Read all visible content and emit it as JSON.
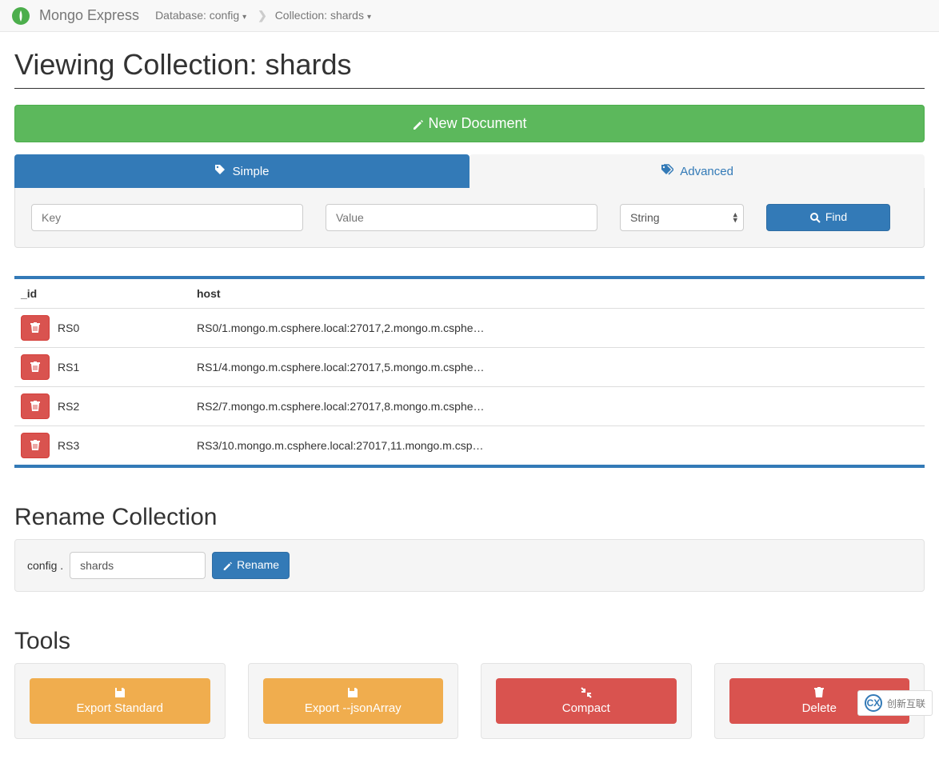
{
  "navbar": {
    "brand": "Mongo Express",
    "db_label": "Database: config",
    "col_label": "Collection: shards"
  },
  "page": {
    "title": "Viewing Collection: shards"
  },
  "new_doc": {
    "label": "New Document"
  },
  "tabs": {
    "simple": "Simple",
    "advanced": "Advanced"
  },
  "search": {
    "key_placeholder": "Key",
    "value_placeholder": "Value",
    "type_value": "String",
    "find_label": "Find"
  },
  "table": {
    "headers": {
      "id": "_id",
      "host": "host"
    },
    "rows": [
      {
        "id": "RS0",
        "host": "RS0/1.mongo.m.csphere.local:27017,2.mongo.m.csphe…"
      },
      {
        "id": "RS1",
        "host": "RS1/4.mongo.m.csphere.local:27017,5.mongo.m.csphe…"
      },
      {
        "id": "RS2",
        "host": "RS2/7.mongo.m.csphere.local:27017,8.mongo.m.csphe…"
      },
      {
        "id": "RS3",
        "host": "RS3/10.mongo.m.csphere.local:27017,11.mongo.m.csp…"
      }
    ]
  },
  "rename": {
    "title": "Rename Collection",
    "prefix": "config .",
    "value": "shards",
    "button": "Rename"
  },
  "tools": {
    "title": "Tools",
    "export_standard": "Export Standard",
    "export_json": "Export --jsonArray",
    "compact": "Compact",
    "delete": "Delete"
  },
  "watermark": {
    "text": "创新互联"
  }
}
